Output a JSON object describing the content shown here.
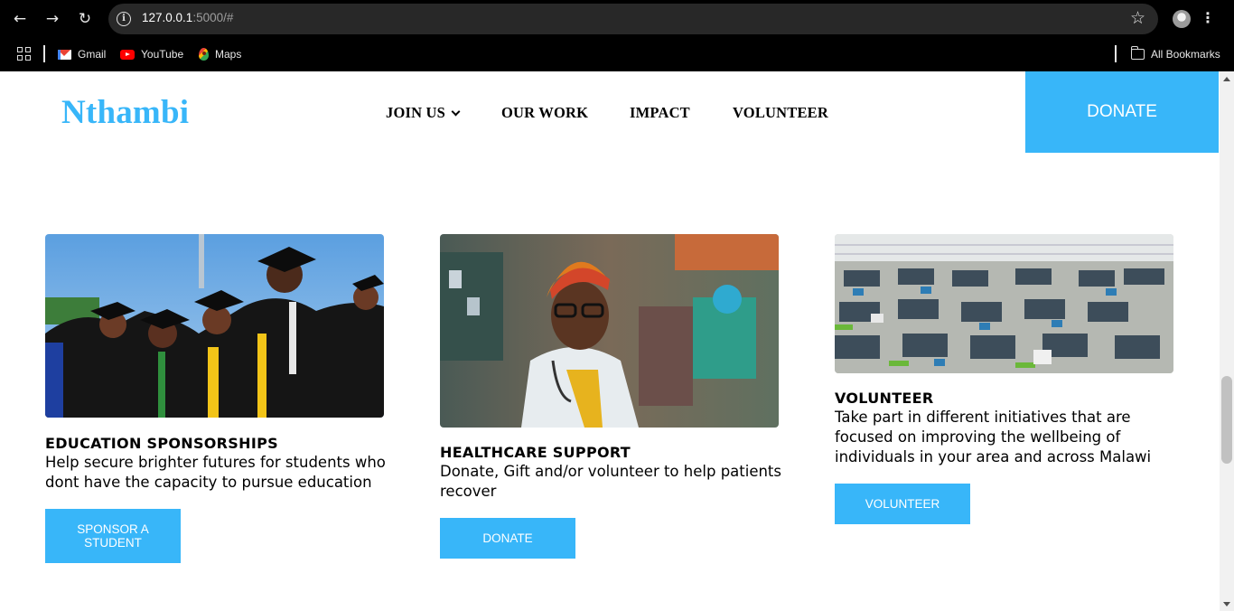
{
  "browser": {
    "url_host": "127.0.0.1",
    "url_rest": ":5000/#",
    "bookmarks": [
      {
        "label": "Gmail",
        "icon": "gmail-icon"
      },
      {
        "label": "YouTube",
        "icon": "youtube-icon"
      },
      {
        "label": "Maps",
        "icon": "maps-icon"
      }
    ],
    "all_bookmarks_label": "All Bookmarks"
  },
  "header": {
    "logo": "Nthambi",
    "nav": [
      {
        "label": "JOIN US",
        "has_dropdown": true
      },
      {
        "label": "OUR WORK"
      },
      {
        "label": "IMPACT"
      },
      {
        "label": "VOLUNTEER"
      }
    ],
    "donate_label": "DONATE"
  },
  "cards": [
    {
      "image": "graduates-photo",
      "title": "EDUCATION SPONSORSHIPS",
      "text": "Help secure brighter futures for students who dont have the capacity to pursue education",
      "button": "SPONSOR A STUDENT"
    },
    {
      "image": "healthcare-worker-photo",
      "title": "HEALTHCARE SUPPORT",
      "text": "Donate, Gift and/or volunteer to help patients recover",
      "button": "DONATE"
    },
    {
      "image": "factory-floor-photo",
      "title": "VOLUNTEER",
      "text": "Take part in different initiatives that are focused on improving the wellbeing of individuals in your area and across Malawi",
      "button": "VOLUNTEER"
    }
  ],
  "colors": {
    "accent": "#38b6f9",
    "chrome_bg": "#000000",
    "omnibox_bg": "#282828"
  }
}
